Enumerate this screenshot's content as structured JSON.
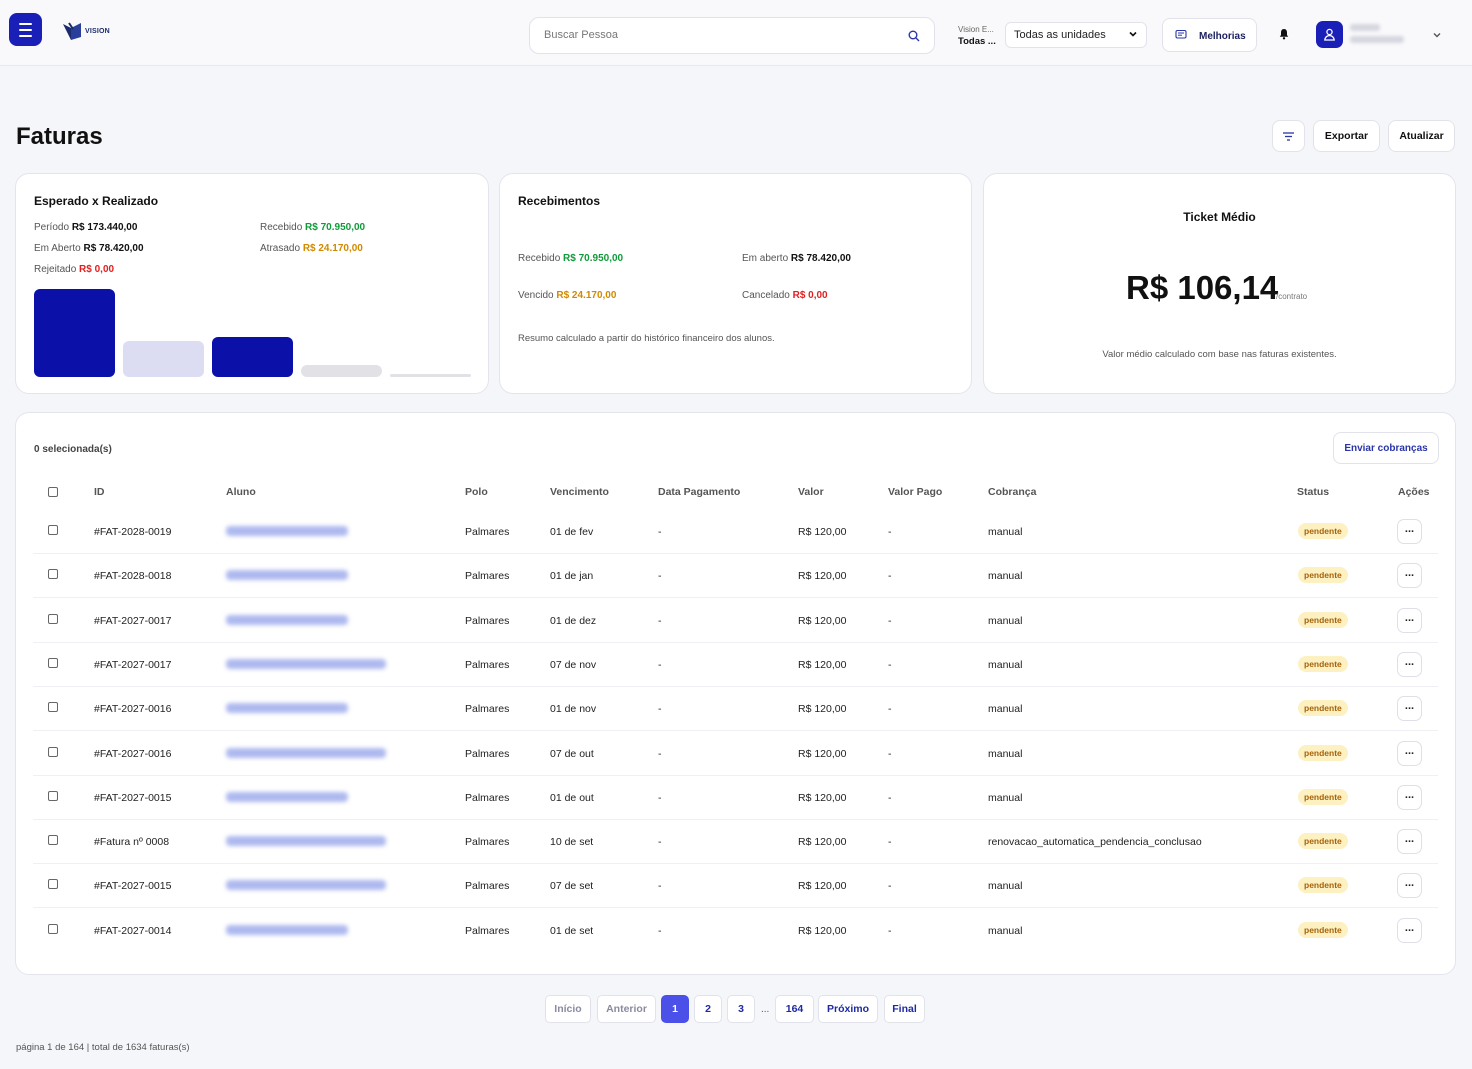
{
  "header": {
    "logo_text": "VISION",
    "search_placeholder": "Buscar Pessoa",
    "unit_label_small": "Vision E...",
    "unit_label_big": "Todas ...",
    "unit_select_value": "Todas as unidades",
    "improvements_label": "Melhorias"
  },
  "page": {
    "title": "Faturas",
    "export_label": "Exportar",
    "refresh_label": "Atualizar"
  },
  "card_expected": {
    "title": "Esperado x Realizado",
    "period_label": "Período",
    "period_value": "R$ 173.440,00",
    "received_label": "Recebido",
    "received_value": "R$ 70.950,00",
    "open_label": "Em Aberto",
    "open_value": "R$ 78.420,00",
    "late_label": "Atrasado",
    "late_value": "R$ 24.170,00",
    "rejected_label": "Rejeitado",
    "rejected_value": "R$ 0,00",
    "bars": [
      {
        "value": 173440.0,
        "color": "#0b10a8"
      },
      {
        "value": 78420.0,
        "color": "#dcdcf2"
      },
      {
        "value": 70950.0,
        "color": "#0b10a8"
      },
      {
        "value": 24170.0,
        "color": "#e2e2e6"
      },
      {
        "value": 0.0,
        "color": "#e2e2e6"
      }
    ]
  },
  "card_receipts": {
    "title": "Recebimentos",
    "received_label": "Recebido",
    "received_value": "R$ 70.950,00",
    "open_label": "Em aberto",
    "open_value": "R$ 78.420,00",
    "overdue_label": "Vencido",
    "overdue_value": "R$ 24.170,00",
    "cancelled_label": "Cancelado",
    "cancelled_value": "R$ 0,00",
    "note": "Resumo calculado a partir do histórico financeiro dos alunos."
  },
  "card_ticket": {
    "title": "Ticket Médio",
    "amount": "R$ 106,14",
    "unit": "/contrato",
    "note": "Valor médio calculado com base nas faturas existentes."
  },
  "table": {
    "selected_count": "0 selecionada(s)",
    "send_label": "Enviar cobranças",
    "columns": [
      "ID",
      "Aluno",
      "Polo",
      "Vencimento",
      "Data Pagamento",
      "Valor",
      "Valor Pago",
      "Cobrança",
      "Status",
      "Ações"
    ],
    "rows": [
      {
        "id": "#FAT-2028-0019",
        "polo": "Palmares",
        "due": "01 de fev",
        "paid_date": "-",
        "value": "R$ 120,00",
        "paid": "-",
        "billing": "manual",
        "status": "pendente",
        "action": "..."
      },
      {
        "id": "#FAT-2028-0018",
        "polo": "Palmares",
        "due": "01 de jan",
        "paid_date": "-",
        "value": "R$ 120,00",
        "paid": "-",
        "billing": "manual",
        "status": "pendente",
        "action": "..."
      },
      {
        "id": "#FAT-2027-0017",
        "polo": "Palmares",
        "due": "01 de dez",
        "paid_date": "-",
        "value": "R$ 120,00",
        "paid": "-",
        "billing": "manual",
        "status": "pendente",
        "action": "..."
      },
      {
        "id": "#FAT-2027-0017",
        "polo": "Palmares",
        "due": "07 de nov",
        "paid_date": "-",
        "value": "R$ 120,00",
        "paid": "-",
        "billing": "manual",
        "status": "pendente",
        "action": "..."
      },
      {
        "id": "#FAT-2027-0016",
        "polo": "Palmares",
        "due": "01 de nov",
        "paid_date": "-",
        "value": "R$ 120,00",
        "paid": "-",
        "billing": "manual",
        "status": "pendente",
        "action": "..."
      },
      {
        "id": "#FAT-2027-0016",
        "polo": "Palmares",
        "due": "07 de out",
        "paid_date": "-",
        "value": "R$ 120,00",
        "paid": "-",
        "billing": "manual",
        "status": "pendente",
        "action": "..."
      },
      {
        "id": "#FAT-2027-0015",
        "polo": "Palmares",
        "due": "01 de out",
        "paid_date": "-",
        "value": "R$ 120,00",
        "paid": "-",
        "billing": "manual",
        "status": "pendente",
        "action": "..."
      },
      {
        "id": "#Fatura nº 0008",
        "polo": "Palmares",
        "due": "10 de set",
        "paid_date": "-",
        "value": "R$ 120,00",
        "paid": "-",
        "billing": "renovacao_automatica_pendencia_conclusao",
        "status": "pendente",
        "action": "..."
      },
      {
        "id": "#FAT-2027-0015",
        "polo": "Palmares",
        "due": "07 de set",
        "paid_date": "-",
        "value": "R$ 120,00",
        "paid": "-",
        "billing": "manual",
        "status": "pendente",
        "action": "..."
      },
      {
        "id": "#FAT-2027-0014",
        "polo": "Palmares",
        "due": "01 de set",
        "paid_date": "-",
        "value": "R$ 120,00",
        "paid": "-",
        "billing": "manual",
        "status": "pendente",
        "action": "..."
      }
    ]
  },
  "pagination": {
    "first": "Início",
    "prev": "Anterior",
    "pages": [
      "1",
      "2",
      "3"
    ],
    "ellipsis": "...",
    "last_page": "164",
    "next": "Próximo",
    "final": "Final",
    "summary": "página 1 de 164 | total de 1634 faturas(s)"
  },
  "colors": {
    "brand": "#1a1fb8",
    "received": "#109b3a",
    "late": "#d18a00",
    "rejected": "#e02020",
    "status_pending_bg": "#fdf1c2"
  }
}
